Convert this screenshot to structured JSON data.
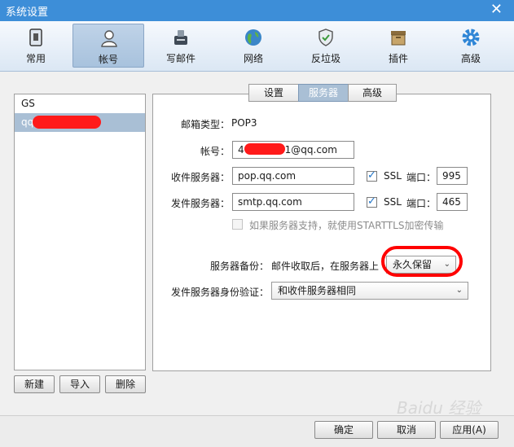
{
  "window": {
    "title": "系统设置",
    "close": "✕"
  },
  "toolbar": [
    {
      "label": "常用"
    },
    {
      "label": "帐号"
    },
    {
      "label": "写邮件"
    },
    {
      "label": "网络"
    },
    {
      "label": "反垃圾"
    },
    {
      "label": "插件"
    },
    {
      "label": "高级"
    }
  ],
  "accounts": [
    {
      "name": "GS"
    },
    {
      "name": "qq(",
      "suffix": "1)"
    }
  ],
  "account_buttons": {
    "new": "新建",
    "import": "导入",
    "delete": "删除"
  },
  "tabs": [
    {
      "label": "设置"
    },
    {
      "label": "服务器"
    },
    {
      "label": "高级"
    }
  ],
  "form": {
    "mail_type_label": "邮箱类型：",
    "mail_type_value": "POP3",
    "account_label": "帐号：",
    "account_prefix": "4",
    "account_suffix": "1@qq.com",
    "incoming_label": "收件服务器：",
    "incoming_value": "pop.qq.com",
    "incoming_ssl": "SSL",
    "incoming_port_label": "端口：",
    "incoming_port": "995",
    "outgoing_label": "发件服务器：",
    "outgoing_value": "smtp.qq.com",
    "outgoing_ssl": "SSL",
    "outgoing_port_label": "端口：",
    "outgoing_port": "465",
    "starttls_label": "如果服务器支持，就使用STARTTLS加密传输",
    "backup_label": "服务器备份：",
    "backup_desc": "邮件收取后，在服务器上",
    "backup_value": "永久保留",
    "auth_label": "发件服务器身份验证：",
    "auth_value": "和收件服务器相同"
  },
  "footer": {
    "ok": "确定",
    "cancel": "取消",
    "apply": "应用(A)"
  },
  "watermark": "Baidu 经验",
  "colors": {
    "titlebar": "#3d8ed8",
    "selected": "#a9bfd5",
    "annotation": "#ff0000"
  }
}
